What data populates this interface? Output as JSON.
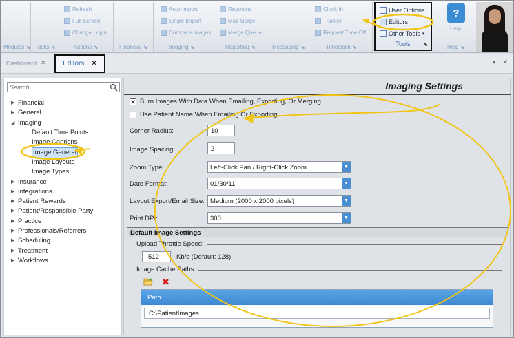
{
  "ribbon": {
    "groups": [
      {
        "title": "Modules",
        "items": []
      },
      {
        "title": "Tasks",
        "items": []
      },
      {
        "title": "Actions",
        "items": [
          "Refresh",
          "Full Screen",
          "Change Login"
        ]
      },
      {
        "title": "Financial",
        "items": []
      },
      {
        "title": "Imaging",
        "items": [
          "Auto-Import",
          "Single Import",
          "Compare Images"
        ]
      },
      {
        "title": "Reporting",
        "items": [
          "Reporting",
          "Mail Merge",
          "Merge Queue"
        ]
      },
      {
        "title": "Messaging",
        "items": []
      },
      {
        "title": "Timeclock",
        "items": [
          "Clock In",
          "Tracker",
          "Request Time Off"
        ]
      }
    ],
    "tools": {
      "title": "Tools",
      "items": [
        "User Options",
        "Editors",
        "Other Tools"
      ]
    },
    "help": {
      "label": "Help",
      "group_title": "Help"
    }
  },
  "tabs": [
    {
      "label": "Dashboard"
    },
    {
      "label": "Editors"
    }
  ],
  "sidebar": {
    "search_placeholder": "Search",
    "tree": [
      {
        "label": "Financial",
        "expanded": false
      },
      {
        "label": "General",
        "expanded": false
      },
      {
        "label": "Imaging",
        "expanded": true
      },
      {
        "label": "Default Time Points",
        "child": true
      },
      {
        "label": "Image Captions",
        "child": true
      },
      {
        "label": "Image General",
        "child": true,
        "selected": true
      },
      {
        "label": "Image Layouts",
        "child": true
      },
      {
        "label": "Image Types",
        "child": true
      },
      {
        "label": "Insurance",
        "expanded": false
      },
      {
        "label": "Integrations",
        "expanded": false
      },
      {
        "label": "Patient Rewards",
        "expanded": false
      },
      {
        "label": "Patient/Responsible Party",
        "expanded": false
      },
      {
        "label": "Practice",
        "expanded": false
      },
      {
        "label": "Professionals/Referrers",
        "expanded": false
      },
      {
        "label": "Scheduling",
        "expanded": false
      },
      {
        "label": "Treatment",
        "expanded": false
      },
      {
        "label": "Workflows",
        "expanded": false
      }
    ]
  },
  "main": {
    "title": "Imaging Settings",
    "checkboxes": [
      {
        "label": "Burn Images With Data When Emailing, Exporting, Or Merging.",
        "checked": true
      },
      {
        "label": "Use Patient Name When Emailing Or Exporting",
        "checked": false
      }
    ],
    "fields": {
      "corner_radius": {
        "label": "Corner Radius:",
        "value": "10"
      },
      "image_spacing": {
        "label": "Image Spacing:",
        "value": "2"
      },
      "zoom_type": {
        "label": "Zoom Type:",
        "value": "Left-Click Pan / Right-Click Zoom"
      },
      "date_format": {
        "label": "Date Format:",
        "value": "01/30/11"
      },
      "layout_export": {
        "label": "Layout Export/Email Size:",
        "value": "Medium (2000 x 2000 pixels)"
      },
      "print_dpi": {
        "label": "Print DPI:",
        "value": "300"
      }
    },
    "default_section": {
      "title": "Default Image Settings",
      "upload_label": "Upload Throttle Speed:",
      "upload_value": "512",
      "upload_unit": "Kb/s (Default: 128)",
      "cache_label": "Image Cache Paths:",
      "grid_header": "Path",
      "grid_rows": [
        "C:\\PatientImages"
      ]
    }
  },
  "colors": {
    "accent": "#3e89d2",
    "annotation": "#f0c419",
    "delete": "#d8201d"
  }
}
